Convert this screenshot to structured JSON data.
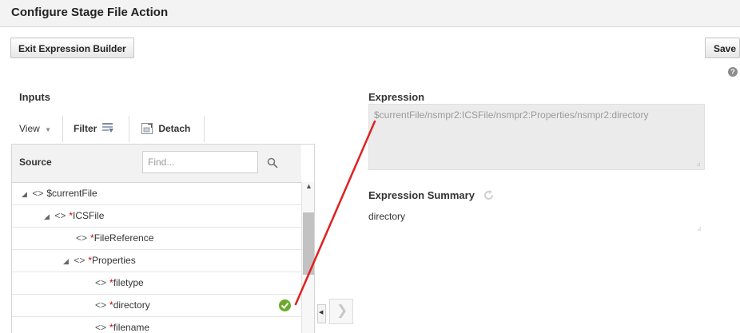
{
  "header": {
    "title": "Configure Stage File Action"
  },
  "toolbar": {
    "exit_label": "Exit Expression Builder",
    "save_label": "Save"
  },
  "inputs": {
    "heading": "Inputs",
    "view_label": "View",
    "filter_label": "Filter",
    "detach_label": "Detach"
  },
  "source": {
    "heading": "Source",
    "search_placeholder": "Find...",
    "tree": [
      {
        "label": "$currentFile",
        "required": false,
        "expanded": true
      },
      {
        "label": "ICSFile",
        "required": true,
        "expanded": true
      },
      {
        "label": "FileReference",
        "required": true,
        "expanded": false
      },
      {
        "label": "Properties",
        "required": true,
        "expanded": true
      },
      {
        "label": "filetype",
        "required": true,
        "expanded": false
      },
      {
        "label": "directory",
        "required": true,
        "expanded": false,
        "selected": true
      },
      {
        "label": "filename",
        "required": true,
        "expanded": false
      }
    ],
    "req_marker": "*",
    "tag_glyph": "<>"
  },
  "expression": {
    "heading": "Expression",
    "value": "$currentFile/nsmpr2:ICSFile/nsmpr2:Properties/nsmpr2:directory"
  },
  "summary": {
    "heading": "Expression Summary",
    "value": "directory"
  },
  "colors": {
    "connector_line": "#e02020",
    "check_badge": "#6bab2b"
  },
  "icons": [
    "filter-icon",
    "detach-icon",
    "search-icon",
    "check-icon",
    "refresh-icon",
    "help-icon"
  ]
}
